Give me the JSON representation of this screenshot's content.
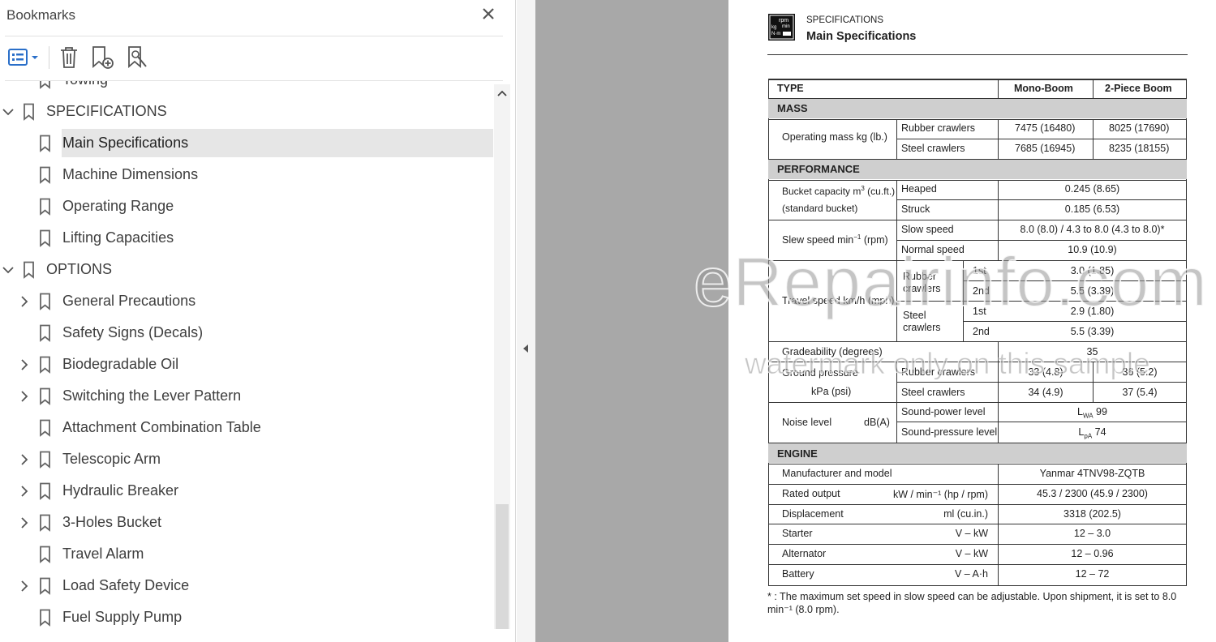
{
  "panel": {
    "title": "Bookmarks"
  },
  "bookmarks": [
    {
      "label": "Towing",
      "level": 2,
      "caret": "none"
    },
    {
      "label": "SPECIFICATIONS",
      "level": 1,
      "caret": "down"
    },
    {
      "label": "Main Specifications",
      "level": 2,
      "caret": "none",
      "selected": true
    },
    {
      "label": "Machine Dimensions",
      "level": 2,
      "caret": "none"
    },
    {
      "label": "Operating Range",
      "level": 2,
      "caret": "none"
    },
    {
      "label": "Lifting Capacities",
      "level": 2,
      "caret": "none"
    },
    {
      "label": "OPTIONS",
      "level": 1,
      "caret": "down"
    },
    {
      "label": "General Precautions",
      "level": 2,
      "caret": "right"
    },
    {
      "label": "Safety Signs (Decals)",
      "level": 2,
      "caret": "none"
    },
    {
      "label": "Biodegradable Oil",
      "level": 2,
      "caret": "right"
    },
    {
      "label": "Switching the Lever Pattern",
      "level": 2,
      "caret": "right"
    },
    {
      "label": "Attachment Combination Table",
      "level": 2,
      "caret": "none"
    },
    {
      "label": "Telescopic Arm",
      "level": 2,
      "caret": "right"
    },
    {
      "label": "Hydraulic Breaker",
      "level": 2,
      "caret": "right"
    },
    {
      "label": "3-Holes Bucket",
      "level": 2,
      "caret": "right"
    },
    {
      "label": "Travel Alarm",
      "level": 2,
      "caret": "none"
    },
    {
      "label": "Load Safety Device",
      "level": 2,
      "caret": "right"
    },
    {
      "label": "Fuel Supply Pump",
      "level": 2,
      "caret": "none"
    }
  ],
  "doc": {
    "section": "SPECIFICATIONS",
    "title": "Main Specifications",
    "icon_text": [
      "rpm",
      "min",
      "kg",
      "N·m"
    ],
    "header": {
      "type": "TYPE",
      "mono": "Mono-Boom",
      "twopiece": "2-Piece Boom"
    },
    "sections": {
      "mass": "MASS",
      "performance": "PERFORMANCE",
      "engine": "ENGINE"
    },
    "mass": {
      "label": "Operating mass  kg (lb.)",
      "rubber": "Rubber crawlers",
      "steel": "Steel crawlers",
      "rubber_mono": "7475 (16480)",
      "rubber_two": "8025 (17690)",
      "steel_mono": "7685 (16945)",
      "steel_two": "8235 (18155)"
    },
    "performance": {
      "bucket_label1": "Bucket capacity m",
      "bucket_label1_sup": "3",
      "bucket_label1_end": " (cu.ft.)",
      "bucket_label2": "(standard bucket)",
      "heaped": "Heaped",
      "heaped_val": "0.245 (8.65)",
      "struck": "Struck",
      "struck_val": "0.185 (6.53)",
      "slew_label": "Slew speed  min",
      "slew_sup": "−1",
      "slew_end": " (rpm)",
      "slow": "Slow speed",
      "slow_val": "8.0 (8.0) / 4.3 to 8.0 (4.3 to 8.0)*",
      "normal": "Normal speed",
      "normal_val": "10.9 (10.9)",
      "travel_label": "Travel speed km/h (mph)",
      "rubber1": "Rubber",
      "rubber2": "crawlers",
      "steel1": "Steel",
      "steel2": "crawlers",
      "first": "1st",
      "second": "2nd",
      "r1_val": "3.0 (1.85)",
      "r2_val": "5.5 (3.39)",
      "s1_val": "2.9 (1.80)",
      "s2_val": "5.5 (3.39)",
      "grade_label": "Gradeability (degrees)",
      "grade_val": "35",
      "ground_label1": "Ground pressure",
      "ground_label2": "kPa (psi)",
      "ground_rubber": "Rubber crawlers",
      "ground_steel": "Steel crawlers",
      "gr_mono": "33 (4.8)",
      "gr_two": "36 (5.2)",
      "gs_mono": "34 (4.9)",
      "gs_two": "37 (5.4)",
      "noise_label": "Noise level",
      "noise_unit": "dB(A)",
      "power_level": "Sound-power level",
      "pressure_level": "Sound-pressure level",
      "lwa_base": "L",
      "lwa_sub": "WA",
      "lwa_val": " 99",
      "lpa_base": "L",
      "lpa_sub": "pA",
      "lpa_val": " 74"
    },
    "engine": {
      "rows": [
        {
          "label": "Manufacturer and model",
          "unit": "",
          "value": "Yanmar 4TNV98-ZQTB"
        },
        {
          "label": "Rated output",
          "unit": "kW / min⁻¹ (hp / rpm)",
          "value": "45.3 / 2300 (45.9 / 2300)"
        },
        {
          "label": "Displacement",
          "unit": "ml (cu.in.)",
          "value": "3318 (202.5)"
        },
        {
          "label": "Starter",
          "unit": "V – kW",
          "value": "12 – 3.0"
        },
        {
          "label": "Alternator",
          "unit": "V – kW",
          "value": "12 – 0.96"
        },
        {
          "label": "Battery",
          "unit": "V – A·h",
          "value": "12 – 72"
        }
      ]
    },
    "footnote": "* : The maximum set speed in slow speed can be adjustable. Upon shipment, it is set to 8.0 min⁻¹ (8.0 rpm)."
  },
  "watermark": {
    "line1": "eRepairinfo.com",
    "line2": "watermark only on this sample"
  }
}
